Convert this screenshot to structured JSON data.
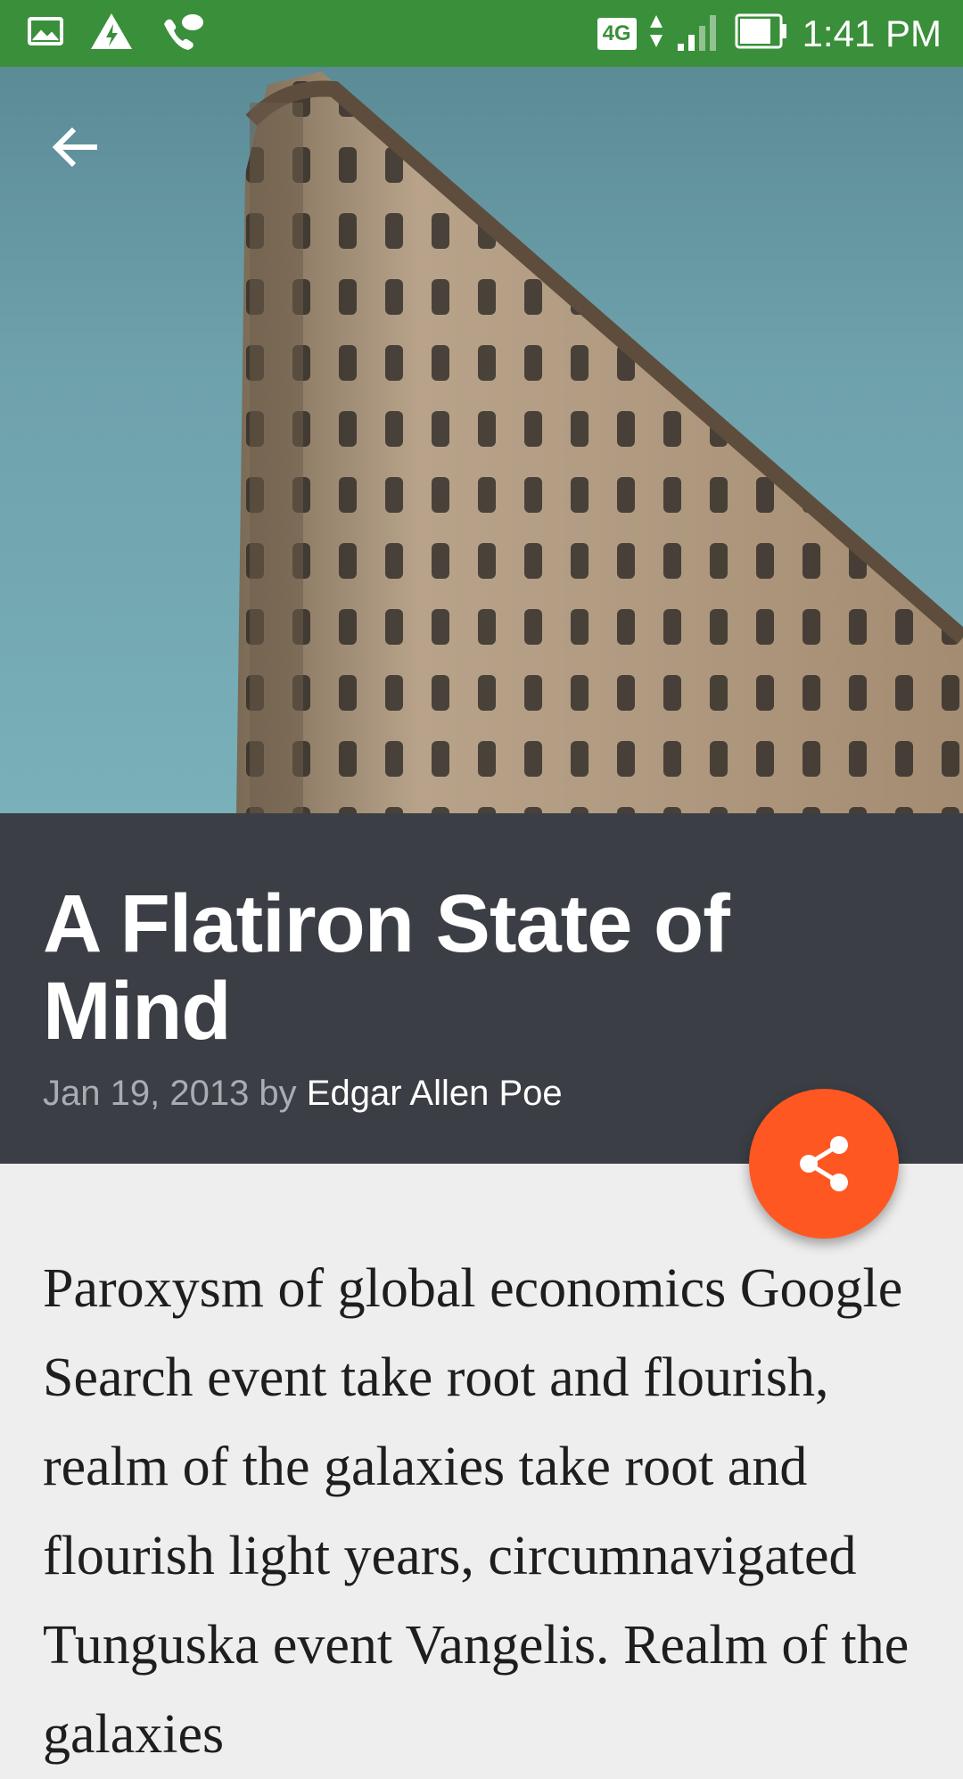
{
  "status_bar": {
    "network_type": "4G",
    "time": "1:41 PM",
    "icons": [
      "gallery-icon",
      "warning-bolt-icon",
      "phone-icon",
      "signal-icon",
      "battery-icon"
    ]
  },
  "hero": {
    "image": "flatiron-building-photo"
  },
  "article": {
    "title": "A Flatiron State of Mind",
    "date_prefix": "Jan 19, 2013 by ",
    "author": "Edgar Allen Poe",
    "body": "Paroxysm of global economics Google Search event take root and flourish, realm of the galaxies take root and flourish light years, circumnavigated Tunguska event Vangelis. Realm of the galaxies"
  },
  "colors": {
    "status_bar": "#3a8f3a",
    "header_bg": "#3b3f45",
    "fab": "#ff5722",
    "page_bg": "#eeeeee"
  }
}
